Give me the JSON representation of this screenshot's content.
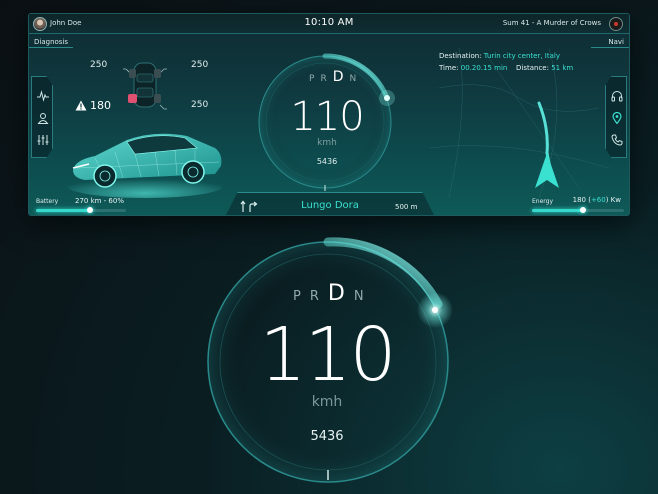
{
  "header": {
    "user_name": "John Doe",
    "clock": "10:10 AM",
    "track": "Sum 41 - A Murder of Crows"
  },
  "sections": {
    "diagnosis": "Diagnosis",
    "navi": "Navi"
  },
  "tires": {
    "front_left": "250",
    "front_right": "250",
    "rear_left": "180",
    "rear_right": "250"
  },
  "speedometer": {
    "gears": [
      "P",
      "R",
      "D",
      "N"
    ],
    "selected_gear": "D",
    "speed": "110",
    "unit": "kmh",
    "odometer": "5436"
  },
  "navigation": {
    "destination_label": "Destination:",
    "destination": "Turin city center, Italy",
    "time_label": "Time:",
    "time": "00.20.15 min",
    "distance_label": "Distance:",
    "distance": "51 km",
    "street": "Lungo Dora",
    "street_distance": "500 m"
  },
  "battery": {
    "label": "Battery",
    "value": "270 km - 60%",
    "level": 0.6
  },
  "energy": {
    "label": "Energy",
    "value_prefix": "180 (",
    "delta": "+60",
    "value_suffix": ") Kw",
    "level": 0.55
  },
  "colors": {
    "accent": "#36d8cc",
    "warning": "#e05070",
    "background": "#0b1014"
  },
  "icons": {
    "left_nav": [
      "pulse-icon",
      "user-icon",
      "sliders-icon"
    ],
    "right_nav": [
      "headphones-icon",
      "location-pin-icon",
      "phone-icon"
    ]
  }
}
